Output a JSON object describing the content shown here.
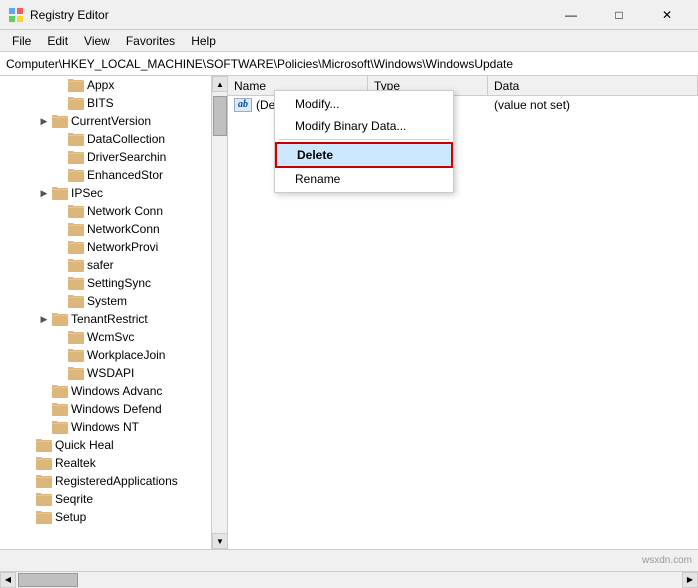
{
  "titleBar": {
    "icon": "registry-editor-icon",
    "title": "Registry Editor",
    "minimize": "—",
    "maximize": "□",
    "close": "✕"
  },
  "menuBar": {
    "items": [
      "File",
      "Edit",
      "View",
      "Favorites",
      "Help"
    ]
  },
  "addressBar": {
    "path": "Computer\\HKEY_LOCAL_MACHINE\\SOFTWARE\\Policies\\Microsoft\\Windows\\WindowsUpdate"
  },
  "treePanel": {
    "items": [
      {
        "label": "Appx",
        "indent": 3,
        "expanded": false,
        "hasArrow": false
      },
      {
        "label": "BITS",
        "indent": 3,
        "expanded": false,
        "hasArrow": false
      },
      {
        "label": "CurrentVersion",
        "indent": 2,
        "expanded": false,
        "hasArrow": true
      },
      {
        "label": "DataCollection",
        "indent": 3,
        "expanded": false,
        "hasArrow": false
      },
      {
        "label": "DriverSearchin",
        "indent": 3,
        "expanded": false,
        "hasArrow": false
      },
      {
        "label": "EnhancedStor",
        "indent": 3,
        "expanded": false,
        "hasArrow": false
      },
      {
        "label": "IPSec",
        "indent": 2,
        "expanded": false,
        "hasArrow": true
      },
      {
        "label": "Network Conn",
        "indent": 3,
        "expanded": false,
        "hasArrow": false
      },
      {
        "label": "NetworkConn",
        "indent": 3,
        "expanded": false,
        "hasArrow": false
      },
      {
        "label": "NetworkProvi",
        "indent": 3,
        "expanded": false,
        "hasArrow": false
      },
      {
        "label": "safer",
        "indent": 3,
        "expanded": false,
        "hasArrow": false
      },
      {
        "label": "SettingSync",
        "indent": 3,
        "expanded": false,
        "hasArrow": false
      },
      {
        "label": "System",
        "indent": 3,
        "expanded": false,
        "hasArrow": false
      },
      {
        "label": "TenantRestrict",
        "indent": 2,
        "expanded": false,
        "hasArrow": true
      },
      {
        "label": "WcmSvc",
        "indent": 3,
        "expanded": false,
        "hasArrow": false
      },
      {
        "label": "WorkplaceJoin",
        "indent": 3,
        "expanded": false,
        "hasArrow": false
      },
      {
        "label": "WSDAPI",
        "indent": 3,
        "expanded": false,
        "hasArrow": false
      },
      {
        "label": "Windows Advanc",
        "indent": 2,
        "expanded": false,
        "hasArrow": false
      },
      {
        "label": "Windows Defend",
        "indent": 2,
        "expanded": false,
        "hasArrow": false
      },
      {
        "label": "Windows NT",
        "indent": 2,
        "expanded": false,
        "hasArrow": false
      },
      {
        "label": "Quick Heal",
        "indent": 1,
        "expanded": false,
        "hasArrow": false
      },
      {
        "label": "Realtek",
        "indent": 1,
        "expanded": false,
        "hasArrow": false
      },
      {
        "label": "RegisteredApplications",
        "indent": 1,
        "expanded": false,
        "hasArrow": false
      },
      {
        "label": "Seqrite",
        "indent": 1,
        "expanded": false,
        "hasArrow": false
      },
      {
        "label": "Setup",
        "indent": 1,
        "expanded": false,
        "hasArrow": false
      }
    ]
  },
  "tableHeader": {
    "name": "Name",
    "type": "Type",
    "data": "Data"
  },
  "tableRows": [
    {
      "name": "(Default)",
      "type": "",
      "data": "(value not set)",
      "icon": "ab"
    }
  ],
  "contextMenu": {
    "items": [
      {
        "label": "Modify...",
        "active": false
      },
      {
        "label": "Modify Binary Data...",
        "active": false
      },
      {
        "label": "Delete",
        "active": true
      },
      {
        "label": "Rename",
        "active": false
      }
    ]
  },
  "statusBar": {
    "text": ""
  },
  "watermark": "wsxdn.com"
}
